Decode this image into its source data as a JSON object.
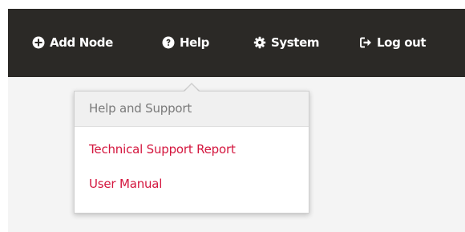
{
  "nav": {
    "items": [
      {
        "label": "Add Node",
        "icon": "plus-circle-icon"
      },
      {
        "label": "Help",
        "icon": "question-circle-icon"
      },
      {
        "label": "System",
        "icon": "gear-icon"
      },
      {
        "label": "Log out",
        "icon": "sign-out-icon"
      }
    ]
  },
  "help_menu": {
    "header": "Help and Support",
    "items": [
      {
        "label": "Technical Support Report"
      },
      {
        "label": "User Manual"
      }
    ]
  },
  "colors": {
    "navbar_bg": "#2b2926",
    "page_bg": "#f4f4f4",
    "link": "#d4163e",
    "header_text": "#7a7a7a"
  }
}
